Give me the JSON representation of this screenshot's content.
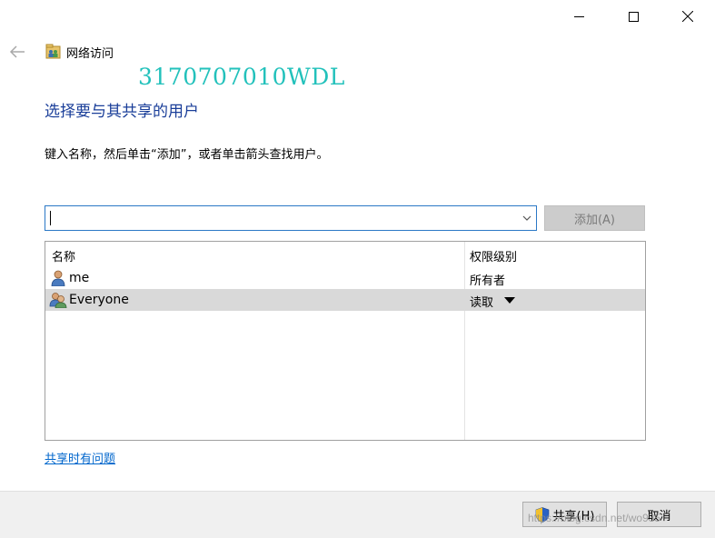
{
  "window": {
    "title": "网络访问",
    "controls": [
      "minimize",
      "maximize",
      "close"
    ]
  },
  "overlay": {
    "student_id": "3170707010WDL",
    "url": "https://blog.csdn.net/wo935"
  },
  "page": {
    "heading": "选择要与其共享的用户",
    "instruction": "键入名称，然后单击“添加”，或者单击箭头查找用户。"
  },
  "input": {
    "value": "",
    "add_button": "添加(A)"
  },
  "table": {
    "columns": [
      "名称",
      "权限级别"
    ],
    "rows": [
      {
        "name": "me",
        "permission": "所有者",
        "icon": "user-icon",
        "selected": false
      },
      {
        "name": "Everyone",
        "permission": "读取",
        "icon": "users-group-icon",
        "selected": true,
        "has_dropdown": true
      }
    ]
  },
  "help_link": "共享时有问题",
  "footer": {
    "share_button": "共享(H)",
    "cancel_button": "取消"
  },
  "colors": {
    "heading": "#1a3e99",
    "link": "#0066cc",
    "watermark": "#22c1bb",
    "focus_border": "#2b78c6",
    "selected_row": "#d9d9d9"
  }
}
